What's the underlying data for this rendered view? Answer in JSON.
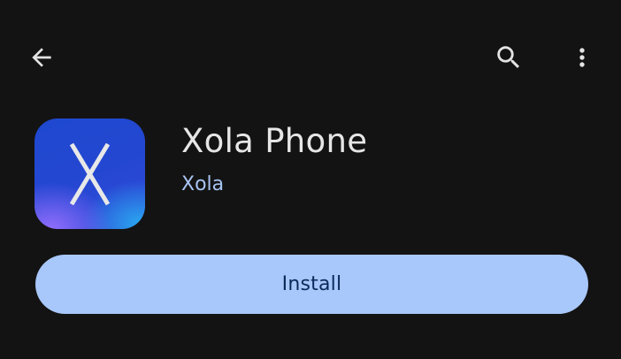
{
  "header": {
    "back_icon": "arrow-back-icon",
    "search_icon": "search-icon",
    "more_icon": "more-vert-icon"
  },
  "app": {
    "name": "Xola Phone",
    "developer": "Xola",
    "icon_letter": "X"
  },
  "actions": {
    "install_label": "Install"
  },
  "colors": {
    "background": "#131313",
    "install_button": "#a8c7fa",
    "install_text": "#0b2a5a",
    "developer_link": "#a8c4f2",
    "title_text": "#e6e6e6",
    "icon_fg": "#e6e6e6"
  }
}
